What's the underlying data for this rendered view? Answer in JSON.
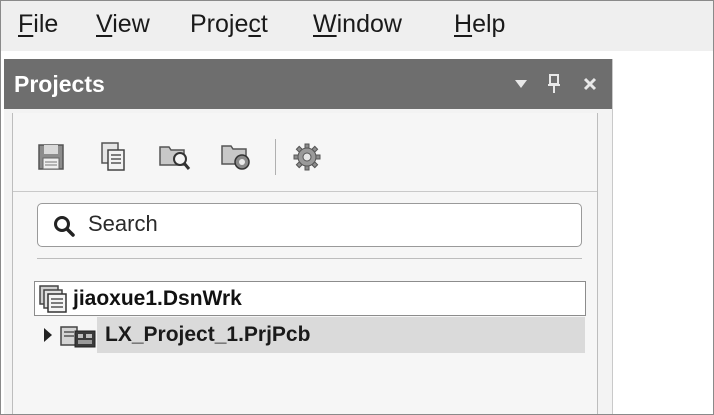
{
  "menu": {
    "file": {
      "pre": "",
      "u": "F",
      "post": "ile"
    },
    "view": {
      "pre": "",
      "u": "V",
      "post": "iew"
    },
    "project": {
      "pre": "Proje",
      "u": "c",
      "post": "t"
    },
    "window": {
      "pre": "",
      "u": "W",
      "post": "indow"
    },
    "help": {
      "pre": "",
      "u": "H",
      "post": "elp"
    }
  },
  "panel": {
    "title": "Projects",
    "header_icons": [
      "dropdown-arrow-icon",
      "pin-icon",
      "close-icon"
    ]
  },
  "toolbar": {
    "icons": [
      "save-icon",
      "copy-files-icon",
      "find-in-files-icon",
      "project-options-icon",
      "settings-gear-icon"
    ]
  },
  "search": {
    "placeholder": "Search"
  },
  "tree": {
    "workspace": {
      "label": "jiaoxue1.DsnWrk",
      "icon": "workspace-icon"
    },
    "project": {
      "label": "LX_Project_1.PrjPcb",
      "icon": "pcb-project-icon",
      "collapsed": true
    }
  },
  "colors": {
    "header_bg": "#6e6e6e",
    "menubar_bg": "#efefef",
    "selection_bg": "#dadada"
  }
}
